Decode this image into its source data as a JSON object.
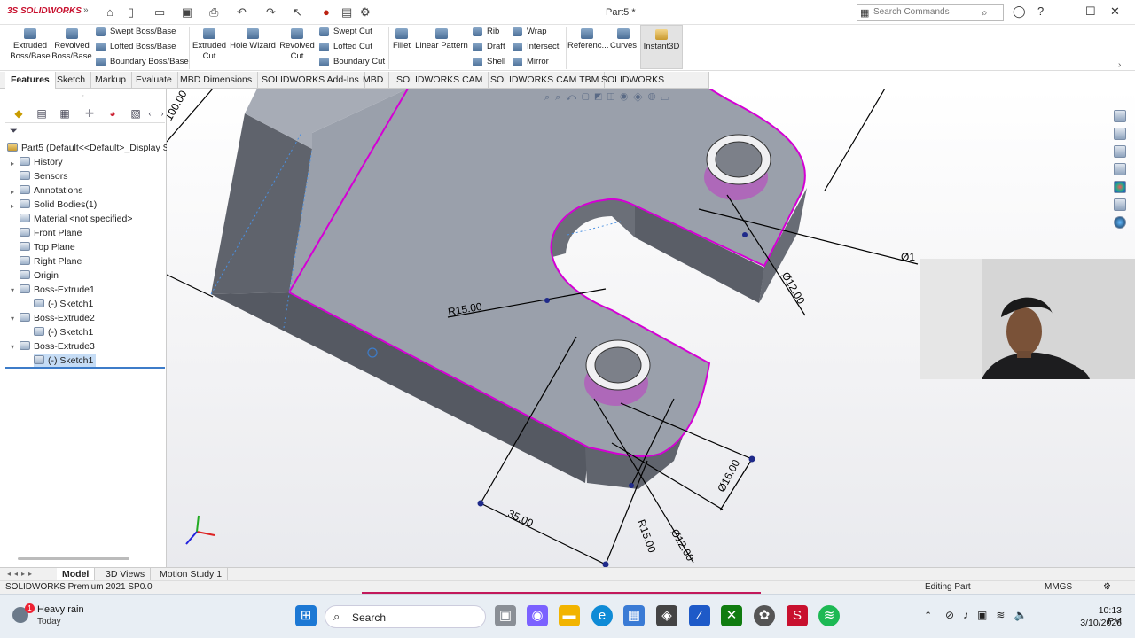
{
  "app": {
    "logo_text": "3S SOLIDWORKS",
    "document_title": "Part5 *",
    "search_placeholder": "Search Commands",
    "qa_more": "»"
  },
  "ribbon": {
    "extruded_boss": "Extruded Boss/Base",
    "revolved_boss": "Revolved Boss/Base",
    "swept_boss": "Swept Boss/Base",
    "lofted_boss": "Lofted Boss/Base",
    "boundary_boss": "Boundary Boss/Base",
    "extruded_cut": "Extruded Cut",
    "hole_wizard": "Hole Wizard",
    "revolved_cut": "Revolved Cut",
    "swept_cut": "Swept Cut",
    "lofted_cut": "Lofted Cut",
    "boundary_cut": "Boundary Cut",
    "fillet": "Fillet",
    "linear_pattern": "Linear Pattern",
    "rib": "Rib",
    "draft": "Draft",
    "shell": "Shell",
    "wrap": "Wrap",
    "intersect": "Intersect",
    "mirror": "Mirror",
    "reference": "Referenc...",
    "curves": "Curves",
    "instant3d": "Instant3D"
  },
  "tabs": [
    "Features",
    "Sketch",
    "Markup",
    "Evaluate",
    "MBD Dimensions",
    "SOLIDWORKS Add-Ins",
    "MBD",
    "SOLIDWORKS CAM",
    "SOLIDWORKS CAM TBM",
    "SOLIDWORKS Inspection"
  ],
  "tree": {
    "root": "Part5  (Default<<Default>_Display S",
    "items": [
      "History",
      "Sensors",
      "Annotations",
      "Solid Bodies(1)",
      "Material <not specified>",
      "Front Plane",
      "Top Plane",
      "Right Plane",
      "Origin",
      "Boss-Extrude1",
      "(-) Sketch1",
      "Boss-Extrude2",
      "(-) Sketch1",
      "Boss-Extrude3",
      "(-) Sketch1"
    ]
  },
  "dimensions": {
    "d100": "100.00",
    "r15a": "R15.00",
    "dia12a": "Ø12.00",
    "d35": "35.00",
    "r15b": "R15.00",
    "dia12b": "Ø12.00",
    "dia16": "Ø16.00",
    "dia_partial": "Ø1"
  },
  "bottom_tabs": [
    "Model",
    "3D Views",
    "Motion Study 1"
  ],
  "status": {
    "left": "SOLIDWORKS Premium 2021 SP0.0",
    "middle": "Editing Part",
    "units": "MMGS"
  },
  "taskbar": {
    "weather_title": "Heavy rain",
    "weather_sub": "Today",
    "weather_badge": "1",
    "search": "Search",
    "time": "10:13 PM",
    "date": "3/10/2026"
  },
  "colors": {
    "brand": "#c8102e",
    "selection_edge": "#d400d4",
    "part_face": "#9aa0ab",
    "part_side": "#5b5f68"
  }
}
